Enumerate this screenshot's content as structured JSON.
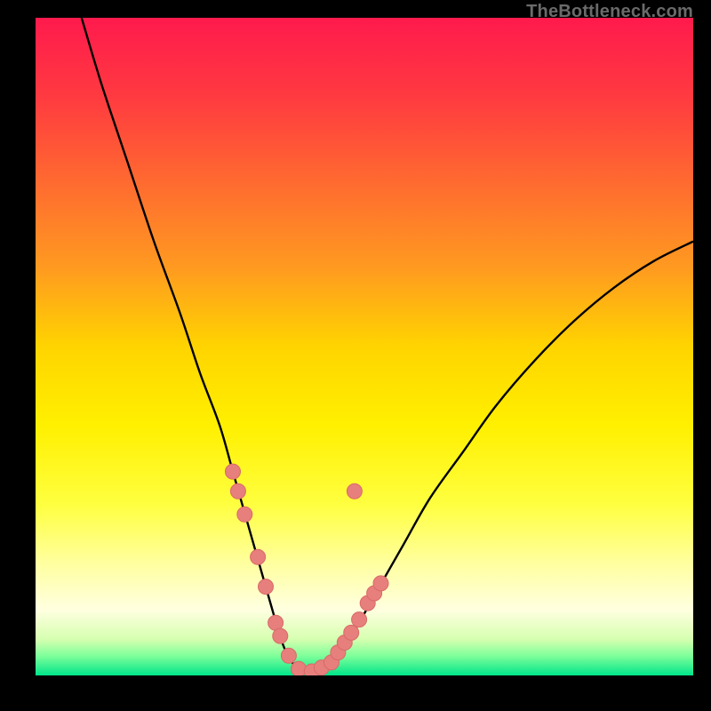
{
  "watermark": "TheBottleneck.com",
  "colors": {
    "frame": "#000000",
    "curve": "#000000",
    "marker_fill": "#e77f7d",
    "marker_stroke": "#d96a68",
    "gradient_stops": [
      {
        "offset": 0.0,
        "color": "#ff1a4d"
      },
      {
        "offset": 0.12,
        "color": "#ff3a40"
      },
      {
        "offset": 0.25,
        "color": "#ff6a30"
      },
      {
        "offset": 0.38,
        "color": "#ff9a20"
      },
      {
        "offset": 0.5,
        "color": "#ffd400"
      },
      {
        "offset": 0.62,
        "color": "#fff000"
      },
      {
        "offset": 0.74,
        "color": "#ffff40"
      },
      {
        "offset": 0.83,
        "color": "#ffffa0"
      },
      {
        "offset": 0.9,
        "color": "#ffffe0"
      },
      {
        "offset": 0.945,
        "color": "#d6ffb0"
      },
      {
        "offset": 0.97,
        "color": "#7fff9a"
      },
      {
        "offset": 1.0,
        "color": "#00e58a"
      }
    ]
  },
  "chart_data": {
    "type": "line",
    "title": "",
    "xlabel": "",
    "ylabel": "",
    "xlim": [
      0,
      100
    ],
    "ylim": [
      0,
      100
    ],
    "series": [
      {
        "name": "bottleneck-curve",
        "x": [
          7,
          10,
          14,
          18,
          22,
          25,
          28,
          30,
          32,
          34,
          36,
          37.5,
          39,
          41,
          43,
          45,
          48,
          52,
          56,
          60,
          65,
          70,
          76,
          82,
          88,
          94,
          100
        ],
        "y": [
          100,
          90,
          78,
          66,
          55,
          46,
          38,
          31,
          24,
          17,
          10,
          5,
          2,
          0.5,
          0.5,
          2,
          6,
          13,
          20,
          27,
          34,
          41,
          48,
          54,
          59,
          63,
          66
        ]
      }
    ],
    "markers": {
      "name": "highlight-points",
      "x": [
        30.0,
        30.8,
        31.8,
        33.8,
        35.0,
        36.5,
        37.2,
        38.5,
        40.0,
        42.0,
        43.5,
        45.0,
        46.0,
        47.0,
        48.0,
        49.2,
        50.5,
        51.5,
        52.5,
        48.5
      ],
      "y": [
        31.0,
        28.0,
        24.5,
        18.0,
        13.5,
        8.0,
        6.0,
        3.0,
        1.0,
        0.6,
        1.2,
        2.0,
        3.5,
        5.0,
        6.5,
        8.5,
        11.0,
        12.5,
        14.0,
        28.0
      ]
    }
  }
}
